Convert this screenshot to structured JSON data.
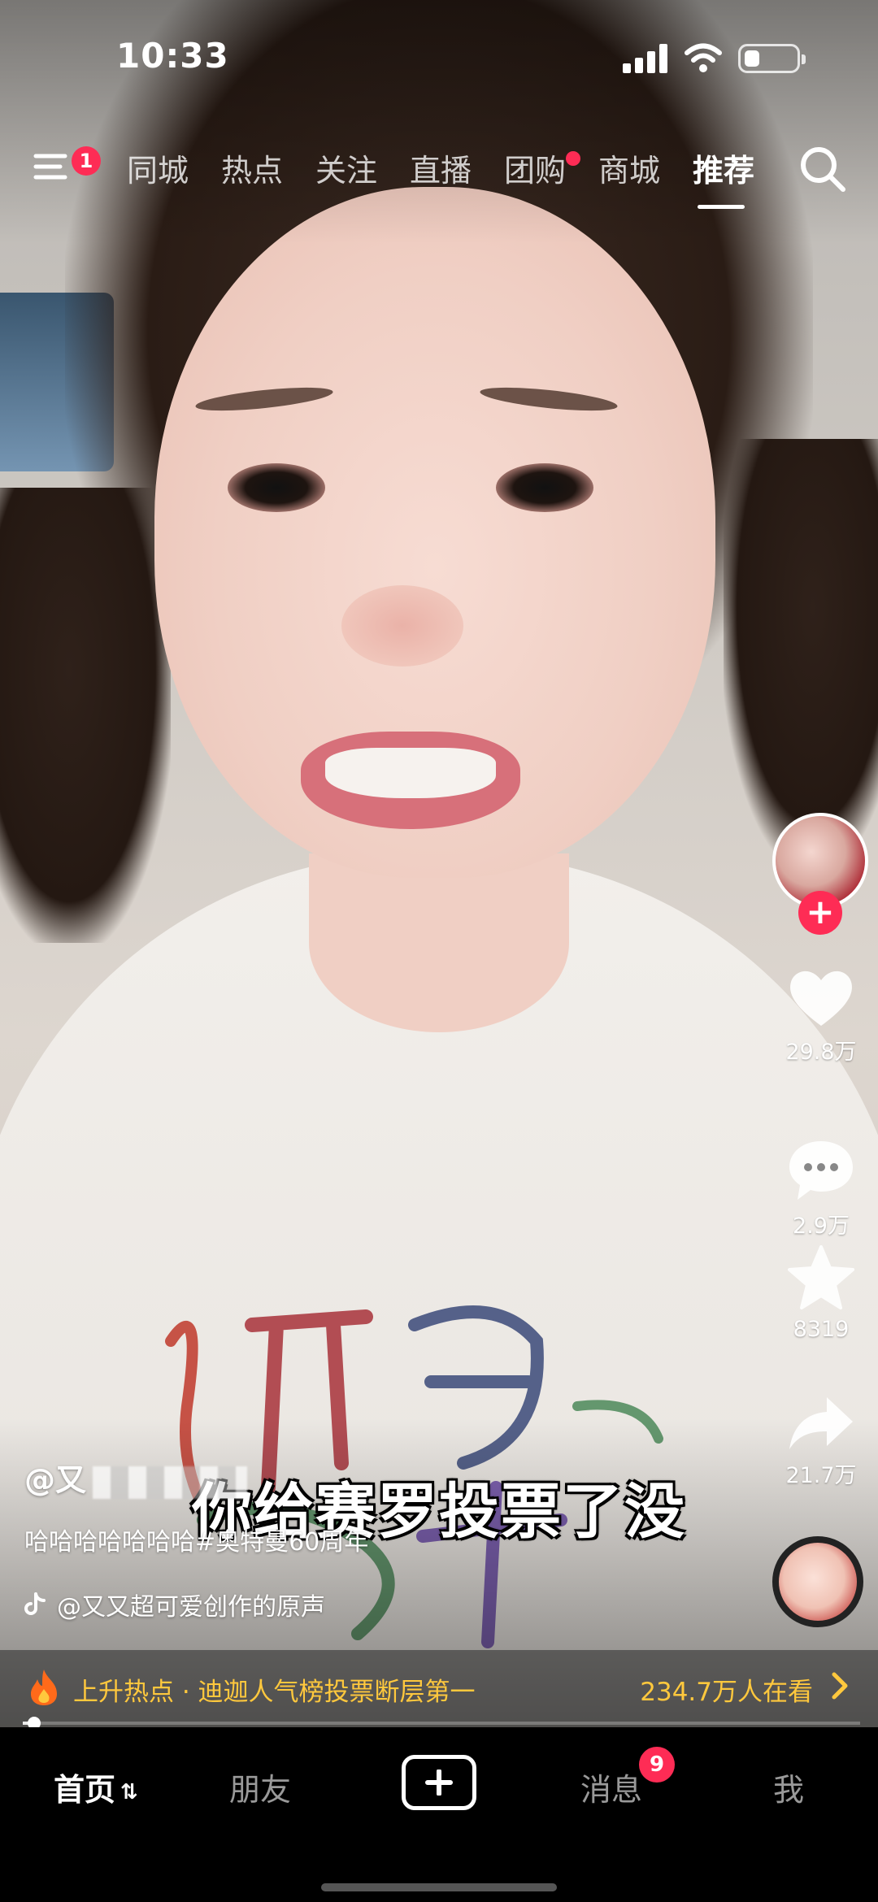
{
  "status_bar": {
    "time": "10:33",
    "battery_level": 0.3
  },
  "top_nav": {
    "menu_badge": "1",
    "tabs": [
      {
        "label": "同城",
        "active": false,
        "dot": false
      },
      {
        "label": "热点",
        "active": false,
        "dot": false
      },
      {
        "label": "关注",
        "active": false,
        "dot": false
      },
      {
        "label": "直播",
        "active": false,
        "dot": false
      },
      {
        "label": "团购",
        "active": false,
        "dot": true
      },
      {
        "label": "商城",
        "active": false,
        "dot": false
      },
      {
        "label": "推荐",
        "active": true,
        "dot": false
      }
    ]
  },
  "video": {
    "caption": "你给赛罗投票了没",
    "author": "@又",
    "description": "哈哈哈哈哈哈哈#奥特曼60周年",
    "music": "@又又超可爱创作的原声",
    "progress": 0.01
  },
  "actions": {
    "likes": "29.8万",
    "comments": "2.9万",
    "favorites": "8319",
    "shares": "21.7万",
    "follow_symbol": "+"
  },
  "hot_bar": {
    "text": "上升热点 · 迪迦人气榜投票断层第一",
    "watching": "234.7万人在看"
  },
  "bottom_nav": {
    "home": "首页",
    "friends": "朋友",
    "messages": "消息",
    "messages_badge": "9",
    "me": "我"
  },
  "colors": {
    "accent": "#fe2c55",
    "hot": "#ffc83d"
  },
  "icons": [
    "menu-icon",
    "search-icon",
    "heart-icon",
    "comment-icon",
    "star-icon",
    "share-icon",
    "tiktok-note-icon",
    "fire-icon",
    "chevron-right-icon",
    "plus-icon",
    "refresh-icon"
  ]
}
